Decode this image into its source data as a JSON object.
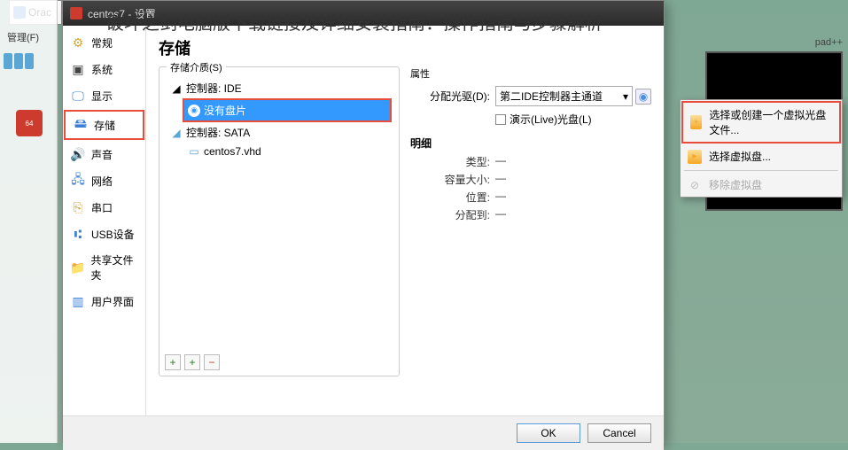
{
  "overlay_title": "破坏之剑电脑版下载链接及详细安装指南：操作指南与步骤解析",
  "parent_app": "Orac",
  "desktop": {
    "manage_menu": "管理(F)",
    "right_label": "pad++"
  },
  "window": {
    "title": "centos7 - 设置"
  },
  "sidebar": {
    "items": [
      {
        "label": "常规",
        "icon": "⚙",
        "color": "#dca43a"
      },
      {
        "label": "系统",
        "icon": "▣",
        "color": "#444"
      },
      {
        "label": "显示",
        "icon": "🖵",
        "color": "#3a7fd5"
      },
      {
        "label": "存储",
        "icon": "🖴",
        "color": "#3a7fd5",
        "selected": true
      },
      {
        "label": "声音",
        "icon": "🔊",
        "color": "#3a7fd5"
      },
      {
        "label": "网络",
        "icon": "🖧",
        "color": "#3a7fd5"
      },
      {
        "label": "串口",
        "icon": "⎘",
        "color": "#c9a04a"
      },
      {
        "label": "USB设备",
        "icon": "⑆",
        "color": "#3a7fd5"
      },
      {
        "label": "共享文件夹",
        "icon": "📁",
        "color": "#3a7fd5"
      },
      {
        "label": "用户界面",
        "icon": "▥",
        "color": "#3a7fd5"
      }
    ]
  },
  "main": {
    "title": "存储",
    "media_legend": "存储介质(S)",
    "tree": {
      "controller_ide": "控制器: IDE",
      "no_disc": "没有盘片",
      "controller_sata": "控制器: SATA",
      "vhd": "centos7.vhd"
    },
    "toolbar": {
      "add_controller": "+",
      "add_attachment": "+",
      "remove": "−"
    },
    "attr_legend": "属性",
    "drive_label": "分配光驱(D):",
    "drive_value": "第二IDE控制器主通道",
    "live_label": "演示(Live)光盘(L)",
    "detail_label": "明细",
    "details": [
      {
        "key": "类型:",
        "val": "—"
      },
      {
        "key": "容量大小:",
        "val": "—"
      },
      {
        "key": "位置:",
        "val": "—"
      },
      {
        "key": "分配到:",
        "val": "—"
      }
    ]
  },
  "buttons": {
    "ok": "OK",
    "cancel": "Cancel"
  },
  "context_menu": {
    "choose_create": "选择或创建一个虚拟光盘文件...",
    "choose_disk": "选择虚拟盘...",
    "remove_disk": "移除虚拟盘"
  }
}
